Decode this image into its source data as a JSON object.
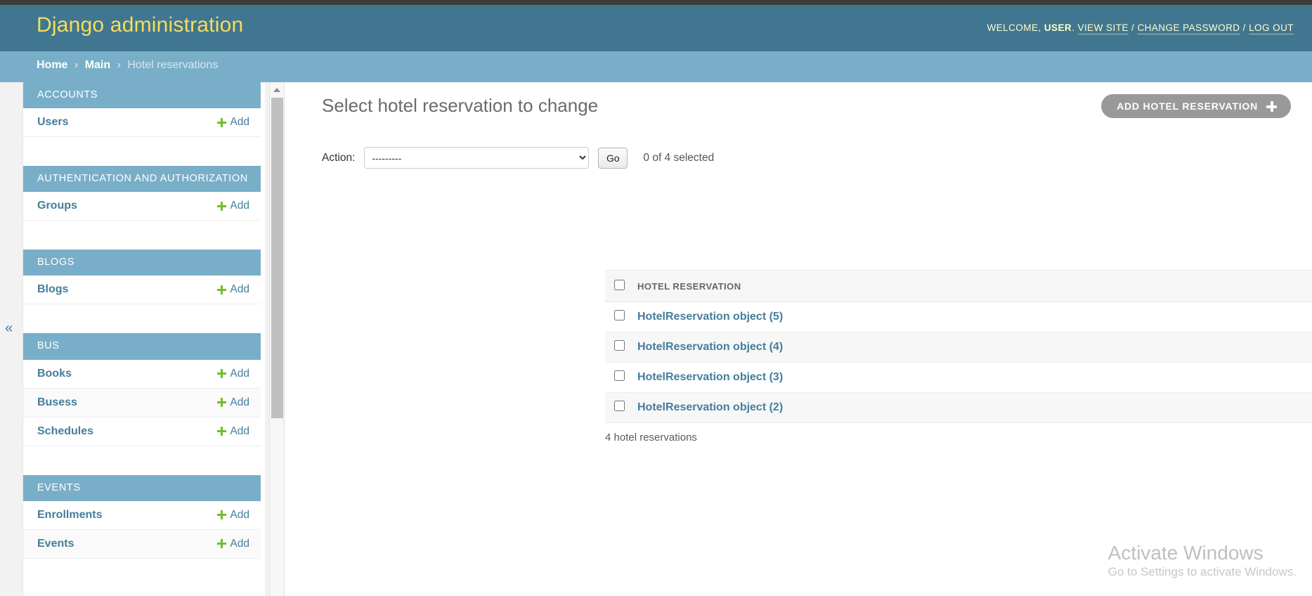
{
  "header": {
    "brand": "Django administration",
    "welcome_prefix": "WELCOME,",
    "username": "USER",
    "period": ".",
    "view_site": "VIEW SITE",
    "change_password": "CHANGE PASSWORD",
    "log_out": "LOG OUT",
    "separator": "/"
  },
  "breadcrumbs": {
    "home": "Home",
    "app": "Main",
    "current": "Hotel reservations",
    "separator": "›"
  },
  "sidebar": {
    "collapse_toggle": "«",
    "add_label": "Add",
    "modules": [
      {
        "caption": "ACCOUNTS",
        "models": [
          {
            "name": "Users"
          }
        ]
      },
      {
        "caption": "AUTHENTICATION AND AUTHORIZATION",
        "models": [
          {
            "name": "Groups"
          }
        ]
      },
      {
        "caption": "BLOGS",
        "models": [
          {
            "name": "Blogs"
          }
        ]
      },
      {
        "caption": "BUS",
        "models": [
          {
            "name": "Books"
          },
          {
            "name": "Busess"
          },
          {
            "name": "Schedules"
          }
        ]
      },
      {
        "caption": "EVENTS",
        "models": [
          {
            "name": "Enrollments"
          },
          {
            "name": "Events"
          }
        ]
      }
    ]
  },
  "content": {
    "title": "Select hotel reservation to change",
    "add_button": "ADD HOTEL RESERVATION",
    "action_label": "Action:",
    "action_selected": "---------",
    "action_options": [
      "---------"
    ],
    "go_button": "Go",
    "selection_counter": "0 of 4 selected",
    "column_header": "HOTEL RESERVATION",
    "rows": [
      {
        "label": "HotelReservation object (5)"
      },
      {
        "label": "HotelReservation object (4)"
      },
      {
        "label": "HotelReservation object (3)"
      },
      {
        "label": "HotelReservation object (2)"
      }
    ],
    "paginator": "4 hotel reservations"
  },
  "watermark": {
    "title": "Activate Windows",
    "subtitle": "Go to Settings to activate Windows."
  },
  "colors": {
    "header_bg": "#417690",
    "breadcrumb_bg": "#79aec8",
    "brand_text": "#f5dd5d",
    "link": "#447e9b",
    "add_green": "#70bf2b",
    "button_gray": "#999999"
  }
}
